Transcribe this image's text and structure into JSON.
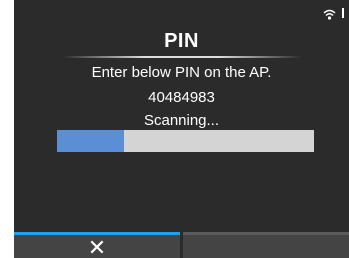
{
  "status_bar": {
    "icons": [
      "wifi-icon",
      "signal-icon"
    ]
  },
  "dialog": {
    "title": "PIN",
    "instruction": "Enter below PIN on the AP.",
    "pin": "40484983",
    "status": "Scanning...",
    "progress_percent": 26
  },
  "footer": {
    "cancel_glyph": "✕",
    "cancel_icon": "close-icon",
    "second_button_label": ""
  },
  "colors": {
    "background": "#2b2b2b",
    "text": "#ffffff",
    "progress_fill": "#5a8fd6",
    "progress_track": "#d4d4d4",
    "active_tab_accent": "#1aa3e8",
    "footer_button": "#444444"
  }
}
